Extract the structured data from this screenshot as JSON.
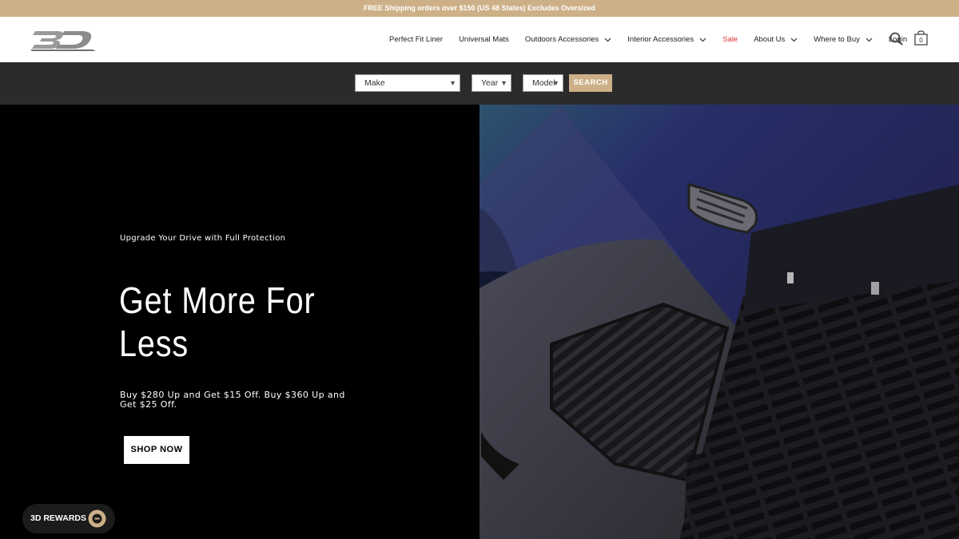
{
  "announcement": {
    "text": "FREE Shipping orders over $150 (US 48 States) Excludes Oversized"
  },
  "brand": {
    "logo_text": "3D"
  },
  "nav": {
    "items": [
      {
        "label": "Perfect Fit Liner",
        "has_dropdown": false
      },
      {
        "label": "Universal Mats",
        "has_dropdown": false
      },
      {
        "label": "Outdoors Accessories",
        "has_dropdown": true
      },
      {
        "label": "Interior Accessories",
        "has_dropdown": true
      },
      {
        "label": "Sale",
        "has_dropdown": false
      },
      {
        "label": "About Us",
        "has_dropdown": true
      },
      {
        "label": "Where to Buy",
        "has_dropdown": true
      },
      {
        "label": "Login",
        "has_dropdown": false
      }
    ],
    "cart_count": "0"
  },
  "filter": {
    "make_label": "Make",
    "year_label": "Year",
    "model_label": "Model",
    "search_label": "SEARCH"
  },
  "hero": {
    "eyebrow": "Upgrade Your Drive with Full Protection",
    "headline": "Get More For Less",
    "promo": "Buy $280 Up and Get $15 Off. Buy $360 Up and Get $25 Off.",
    "cta_label": "SHOP NOW"
  },
  "rewards": {
    "label": "3D REWARDS"
  },
  "colors": {
    "accent": "#cdb087",
    "sale": "#dd3333",
    "bar": "#2b2b2b"
  }
}
